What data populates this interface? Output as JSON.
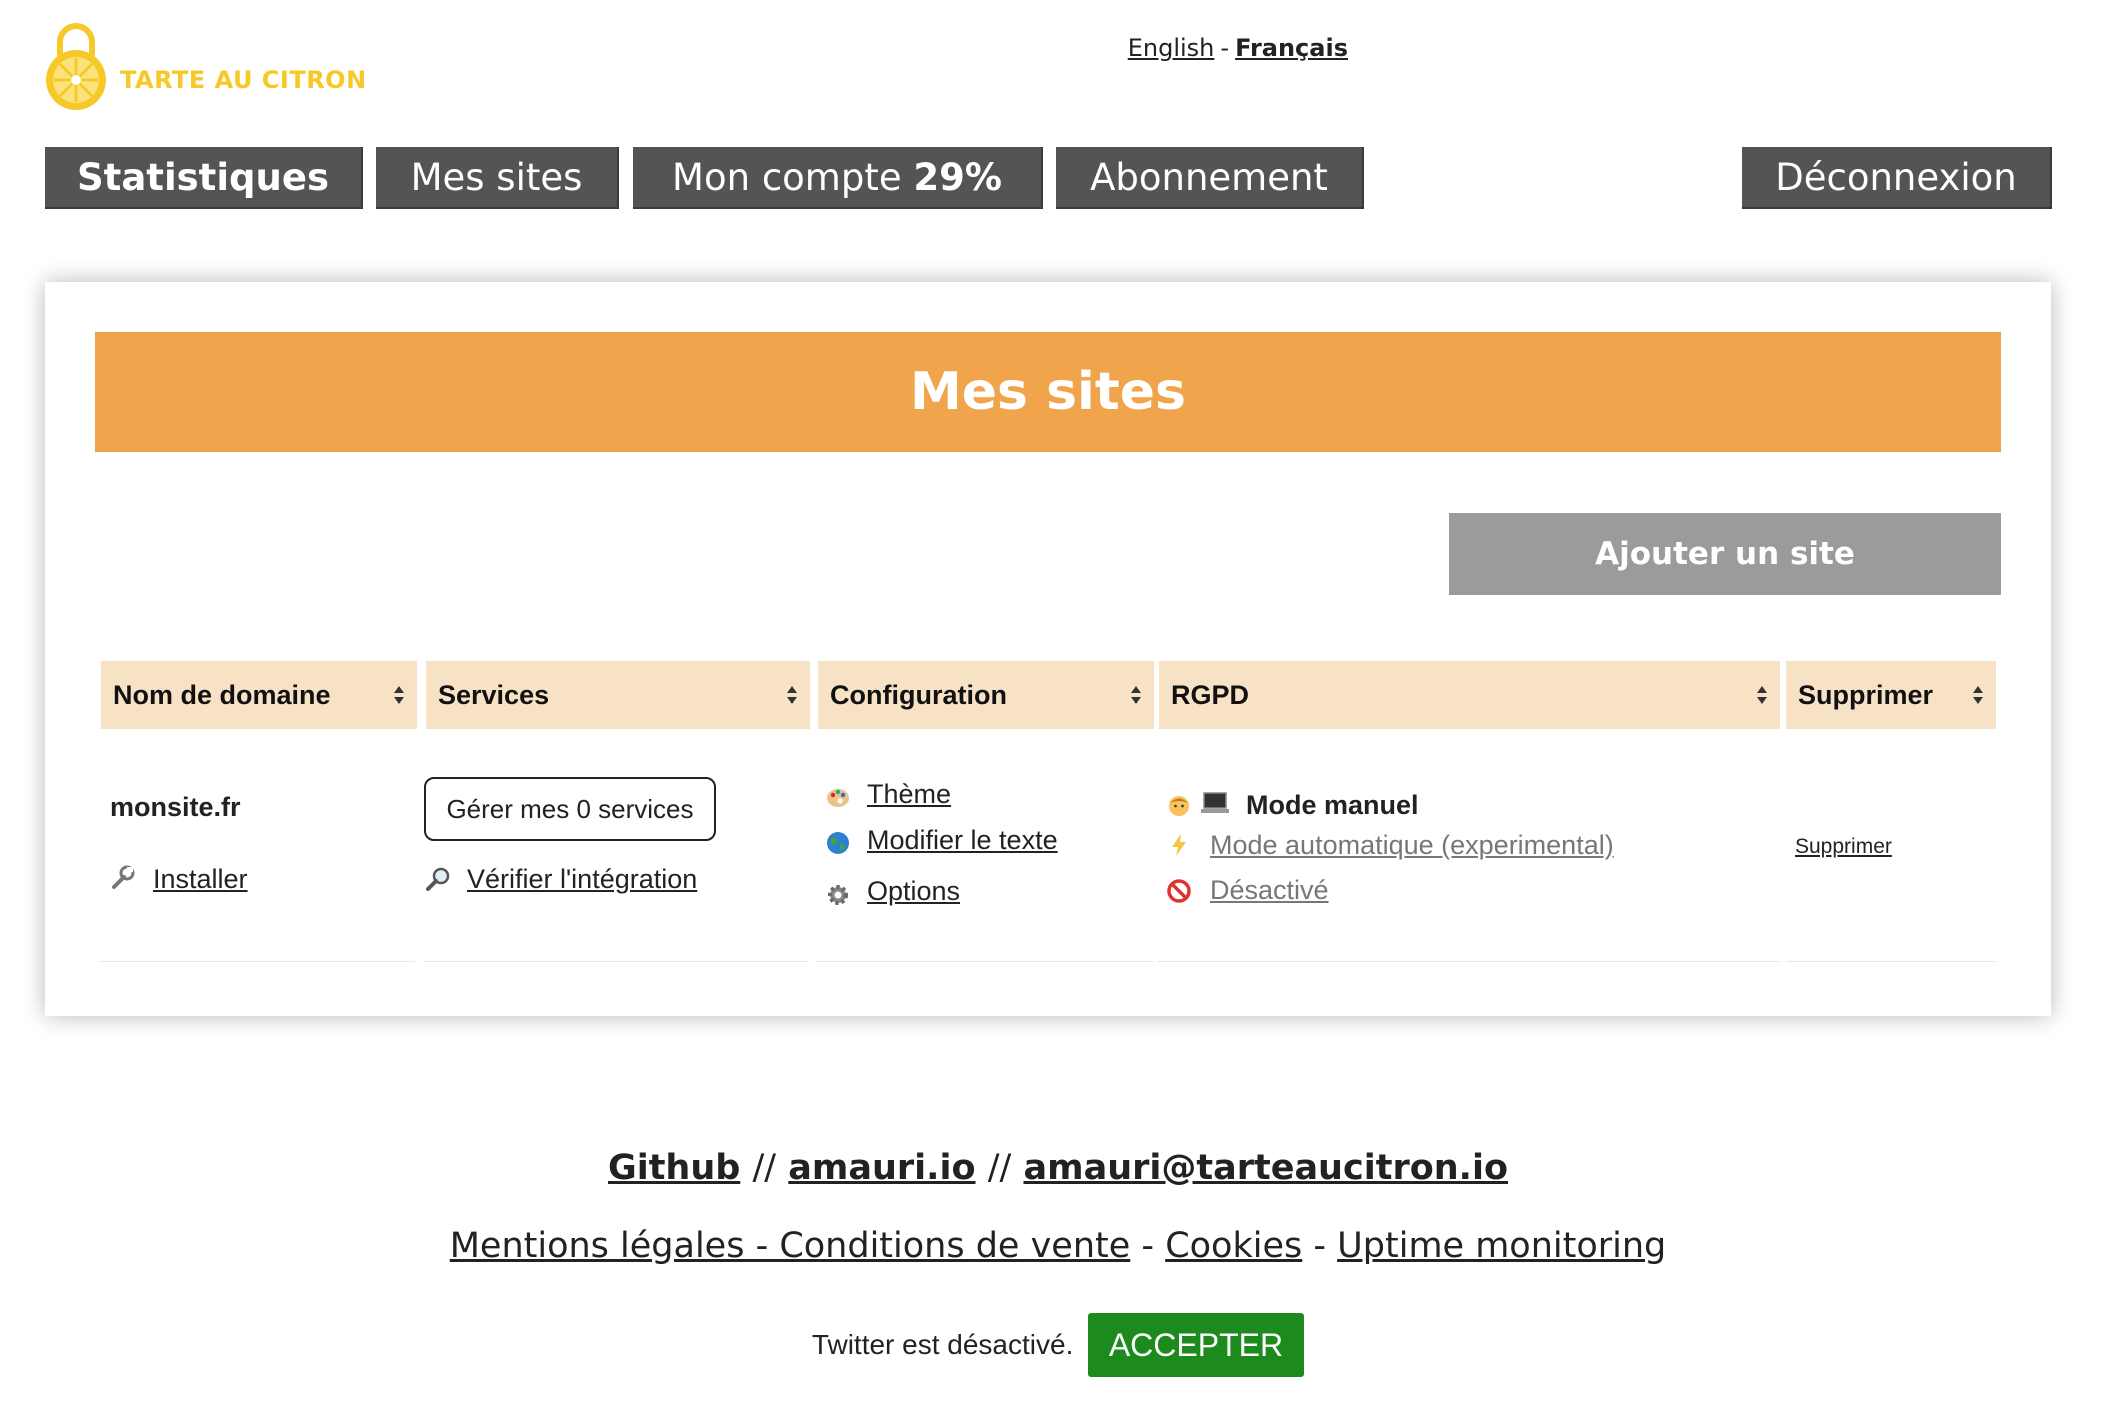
{
  "logo": {
    "text": "TARTE AU CITRON"
  },
  "lang": {
    "english": "English",
    "separator": "-",
    "french": "Français"
  },
  "nav": {
    "stats": "Statistiques",
    "sites": "Mes sites",
    "account": "Mon compte",
    "account_pct": "29%",
    "subscription": "Abonnement",
    "logout": "Déconnexion"
  },
  "main": {
    "title": "Mes sites",
    "add_site": "Ajouter un site",
    "columns": [
      "Nom de domaine",
      "Services",
      "Configuration",
      "RGPD",
      "Supprimer"
    ],
    "row": {
      "domain": "monsite.fr",
      "install": "Installer",
      "manage_services": "Gérer mes 0 services",
      "verify": "Vérifier l'intégration",
      "theme": "Thème",
      "edit_text": "Modifier le texte",
      "options": "Options",
      "mode_manual": "Mode manuel",
      "mode_auto": "Mode automatique (experimental)",
      "disabled": "Désactivé",
      "delete": "Supprimer"
    }
  },
  "footer": {
    "github": "Github",
    "sep": "//",
    "site": "amauri.io",
    "email": "amauri@tarteaucitron.io",
    "legal": "Mentions légales - Conditions de vente",
    "dash": "-",
    "cookies": "Cookies",
    "uptime": "Uptime monitoring"
  },
  "twitter": {
    "text": "Twitter est désactivé.",
    "accept": "ACCEPTER"
  },
  "colors": {
    "nav": "#545454",
    "banner": "#f0a44b",
    "add_button": "#9b9b9b",
    "table_header": "#f8e2c6",
    "accept": "#1d8a1d",
    "logo": "#f6c928"
  }
}
